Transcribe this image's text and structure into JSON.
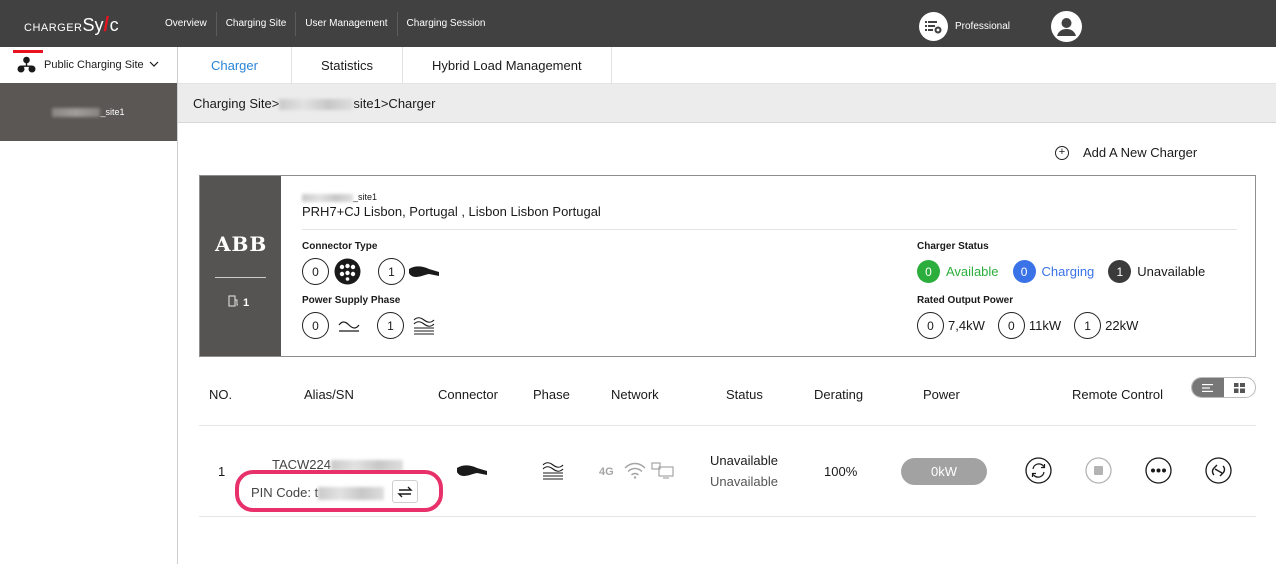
{
  "brand": {
    "prefix": "CHARGER",
    "big": "Sy",
    "suffix": "c"
  },
  "topnav": [
    "Overview",
    "Charging Site",
    "User Management",
    "Charging Session"
  ],
  "user": {
    "role": "Professional"
  },
  "sidebar": {
    "site_selector": "Public Charging Site",
    "sites": [
      {
        "label_suffix": "_site1"
      }
    ]
  },
  "tabs": [
    "Charger",
    "Statistics",
    "Hybrid Load Management"
  ],
  "breadcrumb": {
    "prefix": "Charging Site>",
    "suffix": "site1>Charger"
  },
  "add_charger_label": "Add A New Charger",
  "site_card": {
    "brand": "ABB",
    "charger_count": "1",
    "site_name_suffix": "_site1",
    "address": "PRH7+CJ Lisbon, Portugal , Lisbon Lisbon Portugal",
    "connector_type_label": "Connector Type",
    "connector_counts": [
      "0",
      "1"
    ],
    "power_phase_label": "Power Supply Phase",
    "phase_counts": [
      "0",
      "1"
    ],
    "charger_status_label": "Charger Status",
    "status": [
      {
        "count": "0",
        "label": "Available",
        "color": "#2cae3c"
      },
      {
        "count": "0",
        "label": "Charging",
        "color": "#3a72e8"
      },
      {
        "count": "1",
        "label": "Unavailable",
        "color": "#3b3b3b"
      }
    ],
    "rated_output_label": "Rated Output Power",
    "rated_output": [
      {
        "count": "0",
        "label": "7,4kW"
      },
      {
        "count": "0",
        "label": "11kW"
      },
      {
        "count": "1",
        "label": "22kW"
      }
    ]
  },
  "table": {
    "headers": [
      "NO.",
      "Alias/SN",
      "Connector",
      "Phase",
      "Network",
      "Status",
      "Derating",
      "Power",
      "Remote Control"
    ],
    "rows": [
      {
        "no": "1",
        "sn_prefix": "TACW224",
        "pin_label": "PIN Code: t",
        "network_badge": "4G",
        "status_primary": "Unavailable",
        "status_secondary": "Unavailable",
        "derating": "100%",
        "power": "0kW"
      }
    ]
  },
  "colors": {
    "accent": "#2a84d8",
    "brand_red": "#e8131e",
    "highlight": "#e8306a",
    "topbar": "#414141"
  }
}
